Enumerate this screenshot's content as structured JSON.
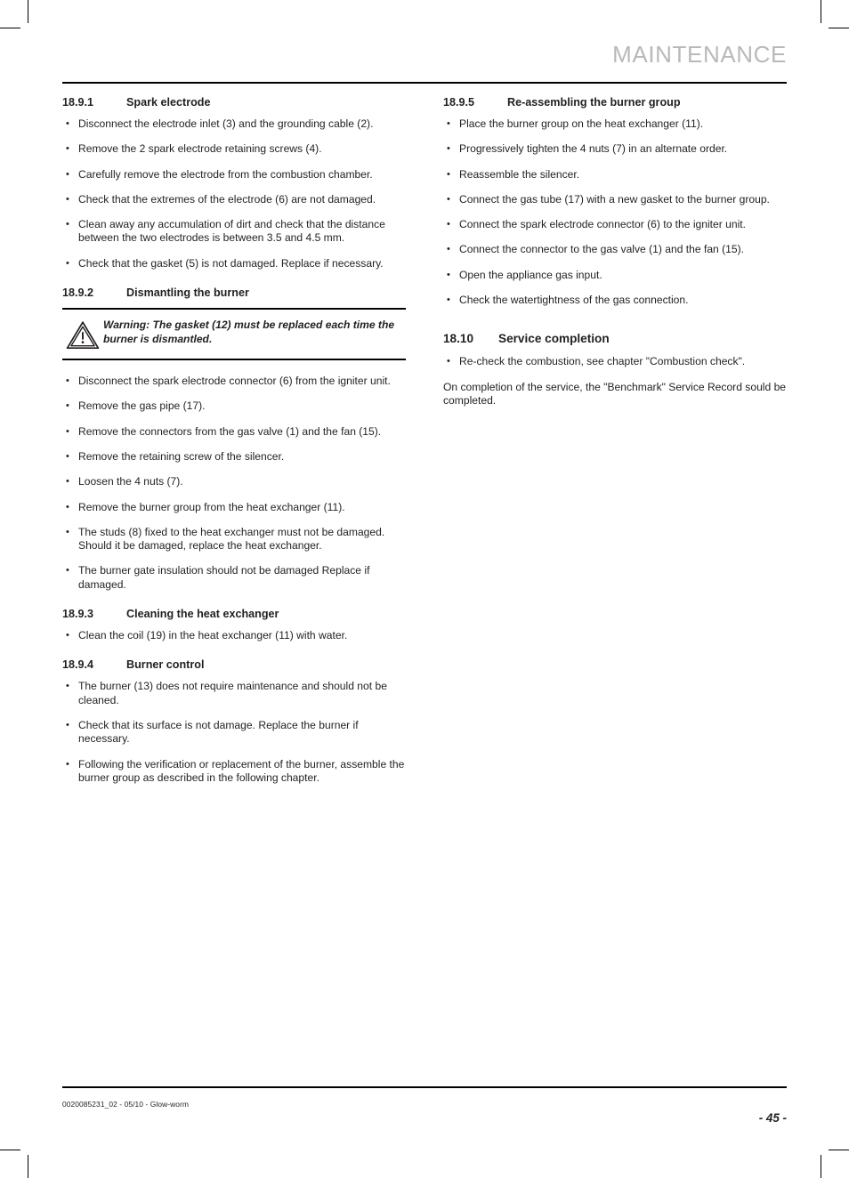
{
  "header": {
    "title": "MAINTENANCE"
  },
  "left_column": {
    "sections": [
      {
        "number": "18.9.1",
        "title": "Spark electrode",
        "bullets": [
          "Disconnect the electrode inlet (3) and the grounding cable (2).",
          "Remove the 2 spark electrode retaining screws (4).",
          "Carefully remove the electrode from the combustion chamber.",
          "Check that the extremes of the electrode (6) are not damaged.",
          "Clean away any accumulation of dirt and check that the distance between the two electrodes is between 3.5 and 4.5 mm.",
          "Check that the gasket (5) is not damaged. Replace if necessary."
        ]
      },
      {
        "number": "18.9.2",
        "title": "Dismantling the burner",
        "warning": {
          "icon": "warning-triangle-icon",
          "text": "Warning: The gasket (12) must be replaced each time the burner is dismantled."
        },
        "bullets": [
          "Disconnect the spark electrode connector (6) from the igniter unit.",
          "Remove the gas pipe (17).",
          "Remove the connectors from the gas valve (1) and the fan (15).",
          "Remove the retaining screw of the silencer.",
          "Loosen the 4 nuts (7).",
          "Remove the burner group from the heat exchanger (11).",
          "The studs (8) fixed to the heat exchanger must not be damaged. Should it be damaged, replace the heat exchanger.",
          "The burner gate insulation should not be damaged Replace if damaged."
        ]
      },
      {
        "number": "18.9.3",
        "title": "Cleaning the heat exchanger",
        "bullets": [
          "Clean the coil (19) in the heat exchanger (11) with water."
        ]
      },
      {
        "number": "18.9.4",
        "title": "Burner control",
        "bullets": [
          "The burner (13) does not require maintenance and should not be cleaned.",
          "Check that its surface is not damage. Replace the burner if necessary.",
          "Following the verification or replacement of the burner, assemble the burner group as described in the following chapter."
        ]
      }
    ]
  },
  "right_column": {
    "sections": [
      {
        "number": "18.9.5",
        "title": "Re-assembling the burner group",
        "bullets": [
          "Place the burner group on the heat exchanger (11).",
          "Progressively tighten the 4 nuts (7) in an alternate order.",
          "Reassemble the silencer.",
          "Connect the gas tube (17) with a new gasket to the burner group.",
          "Connect the spark electrode connector (6) to the igniter unit.",
          "Connect the connector to the gas valve (1) and the fan (15).",
          "Open the appliance gas input.",
          "Check the watertightness of the gas connection."
        ]
      },
      {
        "number": "18.10",
        "title": "Service completion",
        "bullets": [
          "Re-check the combustion, see chapter \"Combustion check\"."
        ],
        "paragraph": "On completion of the service, the \"Benchmark\" Service Record sould be completed."
      }
    ]
  },
  "footer": {
    "document_code": "0020085231_02 - 05/10 - Glow-worm",
    "page_number": "- 45 -"
  },
  "colors": {
    "header_gray": "#b9b9b9",
    "text_black": "#231f20",
    "rule_black": "#000000"
  }
}
